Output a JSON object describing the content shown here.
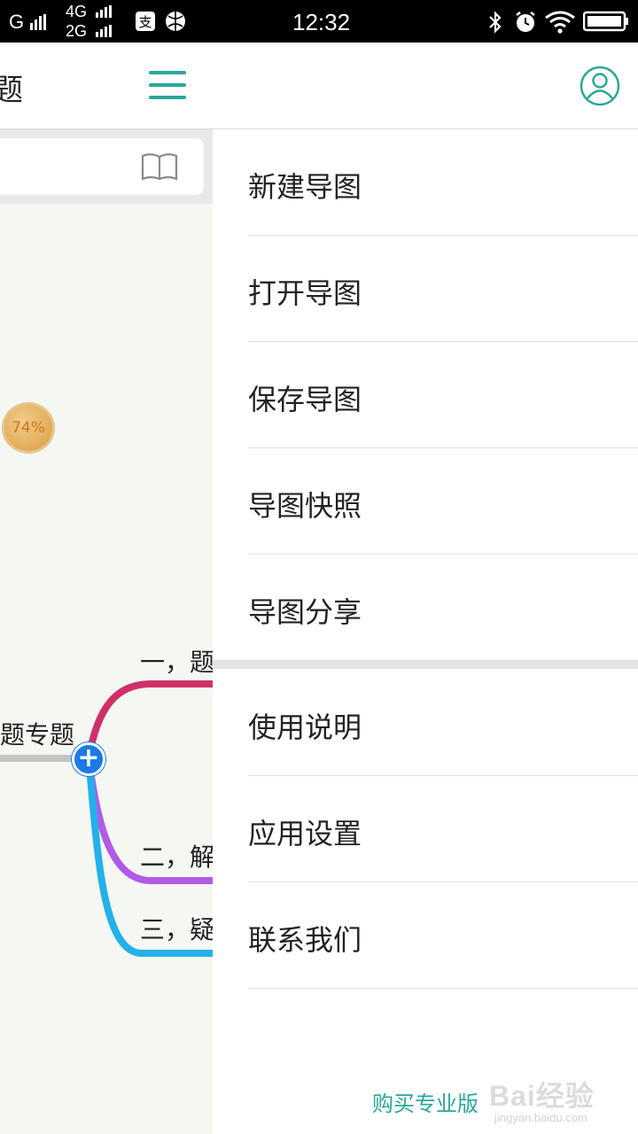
{
  "status_bar": {
    "carrier_1": "G",
    "network_4g": "4G",
    "network_2g": "2G",
    "time": "12:32"
  },
  "app_bar": {
    "title": "题"
  },
  "mind_map": {
    "progress_label": "74%",
    "root_label": "题专题",
    "branches": [
      {
        "label": "一，题",
        "color": "#d0306a"
      },
      {
        "label": "二，解",
        "color": "#b05ae8"
      },
      {
        "label": "三，疑",
        "color": "#23b1ea"
      }
    ]
  },
  "drawer": {
    "items": [
      {
        "label": "新建导图"
      },
      {
        "label": "打开导图"
      },
      {
        "label": "保存导图"
      },
      {
        "label": "导图快照"
      },
      {
        "label": "导图分享"
      },
      {
        "label": "使用说明"
      },
      {
        "label": "应用设置"
      },
      {
        "label": "联系我们"
      }
    ],
    "buy_label": "购买专业版"
  },
  "watermark": {
    "main": "Bai经验",
    "sub": "jingyan.baidu.com"
  },
  "colors": {
    "accent": "#2aa79a",
    "plus_node": "#1c79e5"
  }
}
